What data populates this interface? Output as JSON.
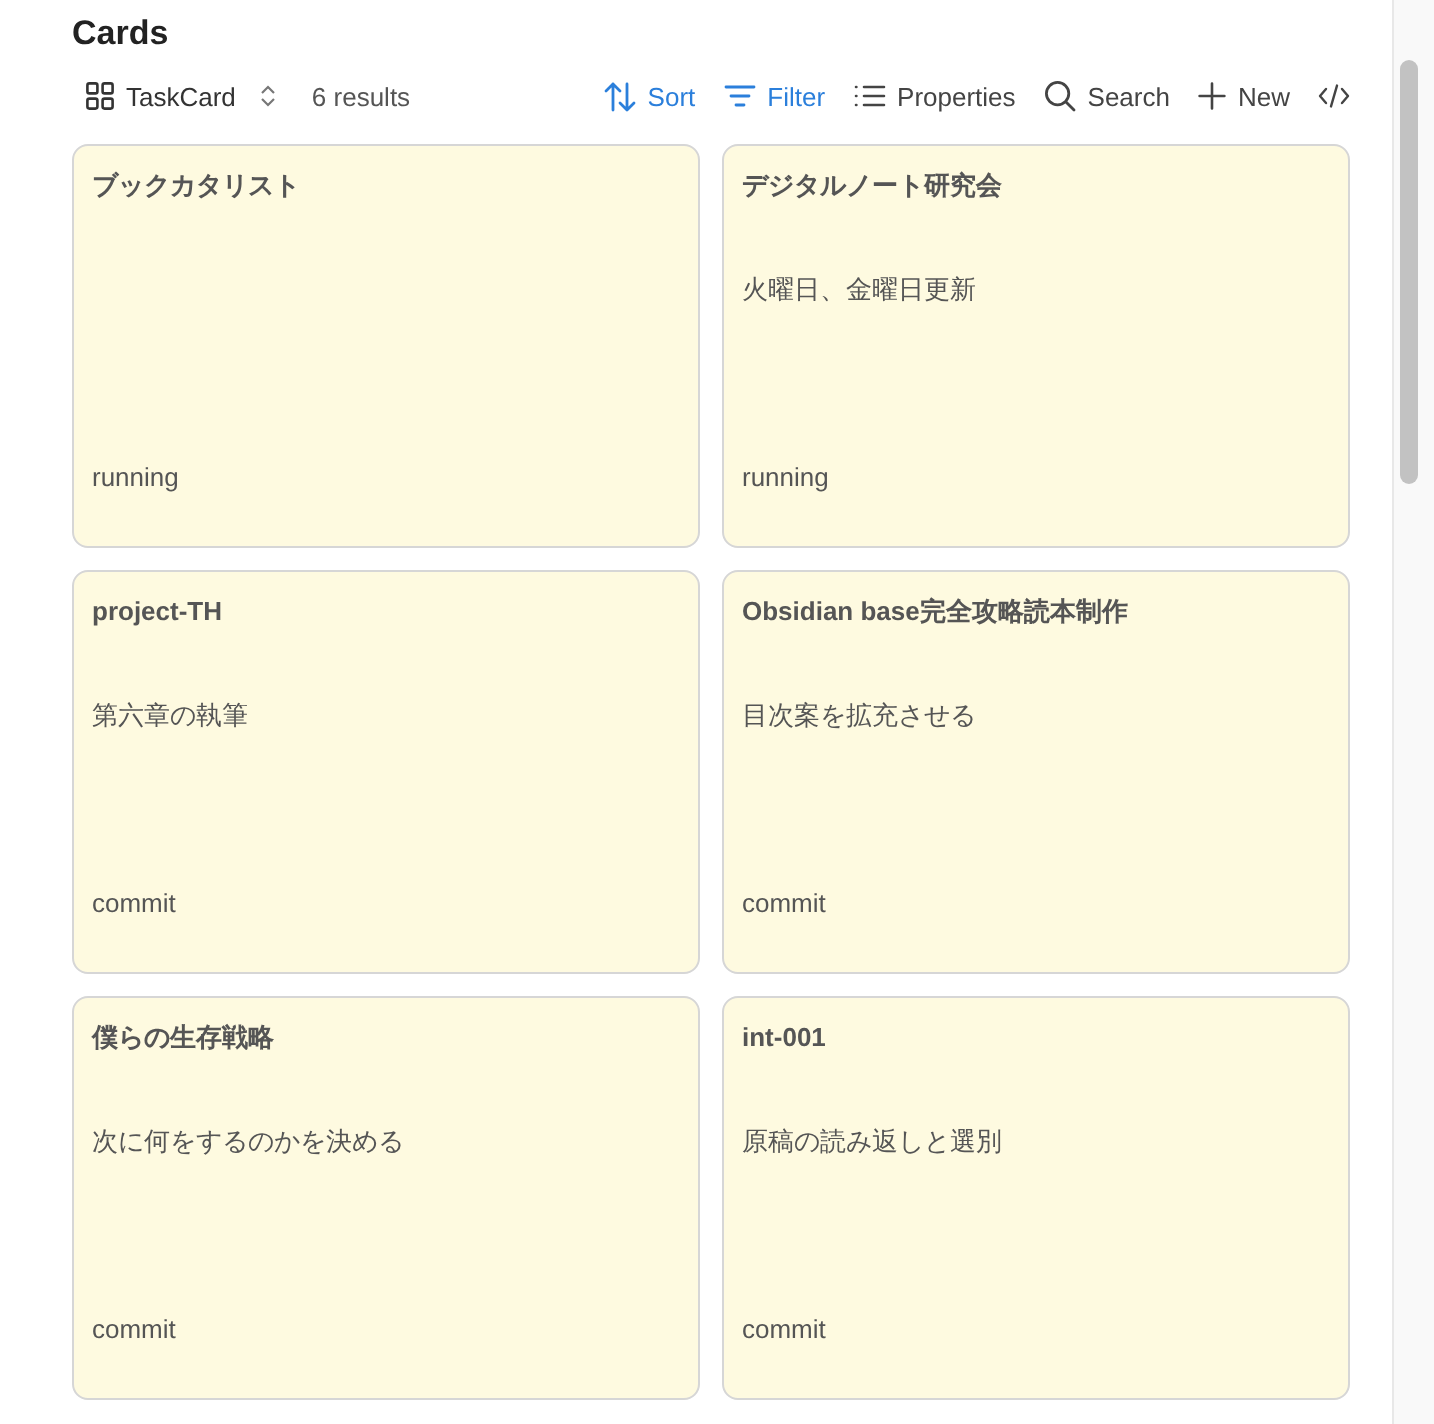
{
  "title": "Cards",
  "toolbar": {
    "view": {
      "label": "TaskCard"
    },
    "result_count": "6 results",
    "actions": [
      {
        "kind": "sort",
        "label": "Sort",
        "active": true
      },
      {
        "kind": "filter",
        "label": "Filter",
        "active": true
      },
      {
        "kind": "properties",
        "label": "Properties",
        "active": false
      },
      {
        "kind": "search",
        "label": "Search",
        "active": false
      },
      {
        "kind": "new",
        "label": "New",
        "active": false
      },
      {
        "kind": "code",
        "active": false
      }
    ]
  },
  "cards": [
    {
      "title": "ブックカタリスト",
      "status": "running"
    },
    {
      "title": "デジタルノート研究会",
      "description": "火曜日、金曜日更新",
      "status": "running"
    },
    {
      "title": "project-TH",
      "description": "第六章の執筆",
      "status": "commit"
    },
    {
      "title": "Obsidian base完全攻略読本制作",
      "description": "目次案を拡充させる",
      "status": "commit"
    },
    {
      "title": "僕らの生存戦略",
      "description": "次に何をするのかを決める",
      "status": "commit"
    },
    {
      "title": "int-001",
      "description": "原稿の読み返しと選別",
      "status": "commit"
    }
  ]
}
